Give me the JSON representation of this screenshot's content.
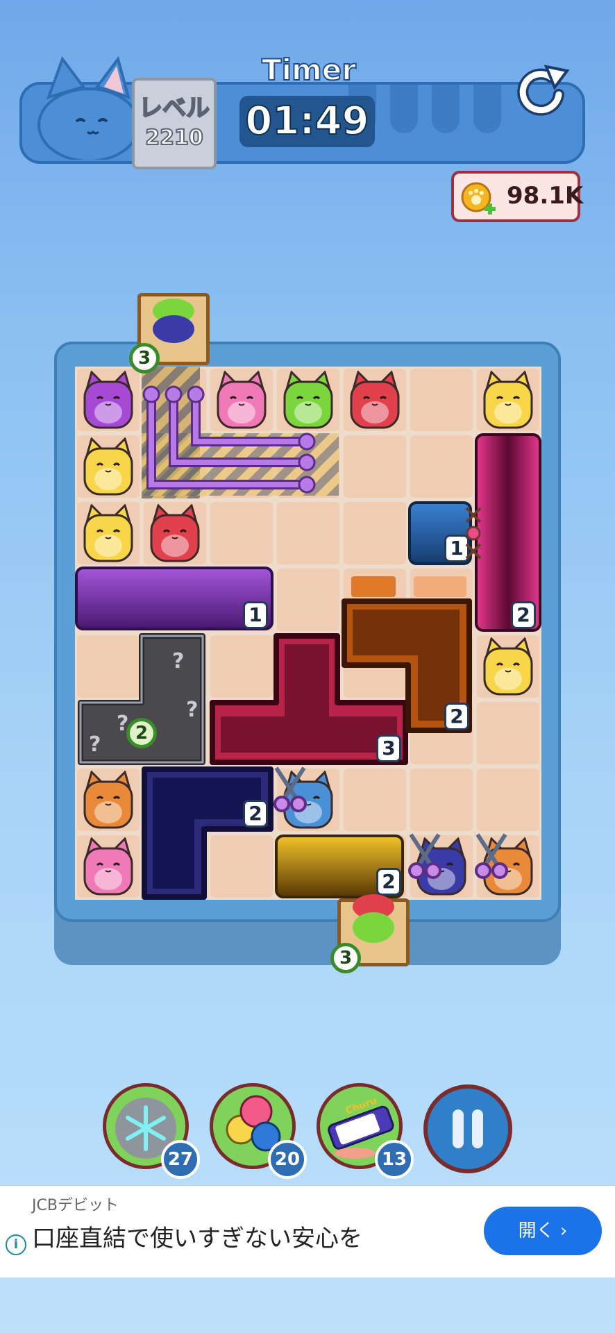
{
  "header": {
    "level_label": "レベル",
    "level_number": "2210",
    "timer_label": "Timer",
    "timer_value": "01:49",
    "coins": "98.1K"
  },
  "board": {
    "blocks": [
      {
        "color": "#8a3fbf",
        "count": "1"
      },
      {
        "color": "#c2185b",
        "count": "2"
      },
      {
        "color": "#1e5a9a",
        "count": "1"
      },
      {
        "color": "#8f9399",
        "count": "2"
      },
      {
        "color": "#b8234a",
        "count": "3"
      },
      {
        "color": "#b45410",
        "count": "2"
      },
      {
        "color": "#2c2a7a",
        "count": "2"
      },
      {
        "color": "#d4a00e",
        "count": "2"
      }
    ],
    "boxes": [
      {
        "count": "3"
      },
      {
        "count": "3"
      }
    ],
    "cats": [
      {
        "color": "#a64ad6"
      },
      {
        "color": "#f07ab8"
      },
      {
        "color": "#7bd63e"
      },
      {
        "color": "#e0414d"
      },
      {
        "color": "#f7d64a"
      },
      {
        "color": "#f7d64a"
      },
      {
        "color": "#f7d64a"
      },
      {
        "color": "#e0414d"
      },
      {
        "color": "#f7d64a"
      },
      {
        "color": "#e88a3a"
      },
      {
        "color": "#4b8fd6"
      },
      {
        "color": "#f07ab8"
      },
      {
        "color": "#3b3ba8"
      },
      {
        "color": "#e88a3a"
      }
    ]
  },
  "boosters": [
    {
      "name": "freeze",
      "count": "27"
    },
    {
      "name": "balloons",
      "count": "20"
    },
    {
      "name": "churu",
      "count": "13",
      "label": "Churu"
    }
  ],
  "ad": {
    "brand": "JCBデビット",
    "message": "口座直結で使いすぎない安心を",
    "button": "開く"
  }
}
